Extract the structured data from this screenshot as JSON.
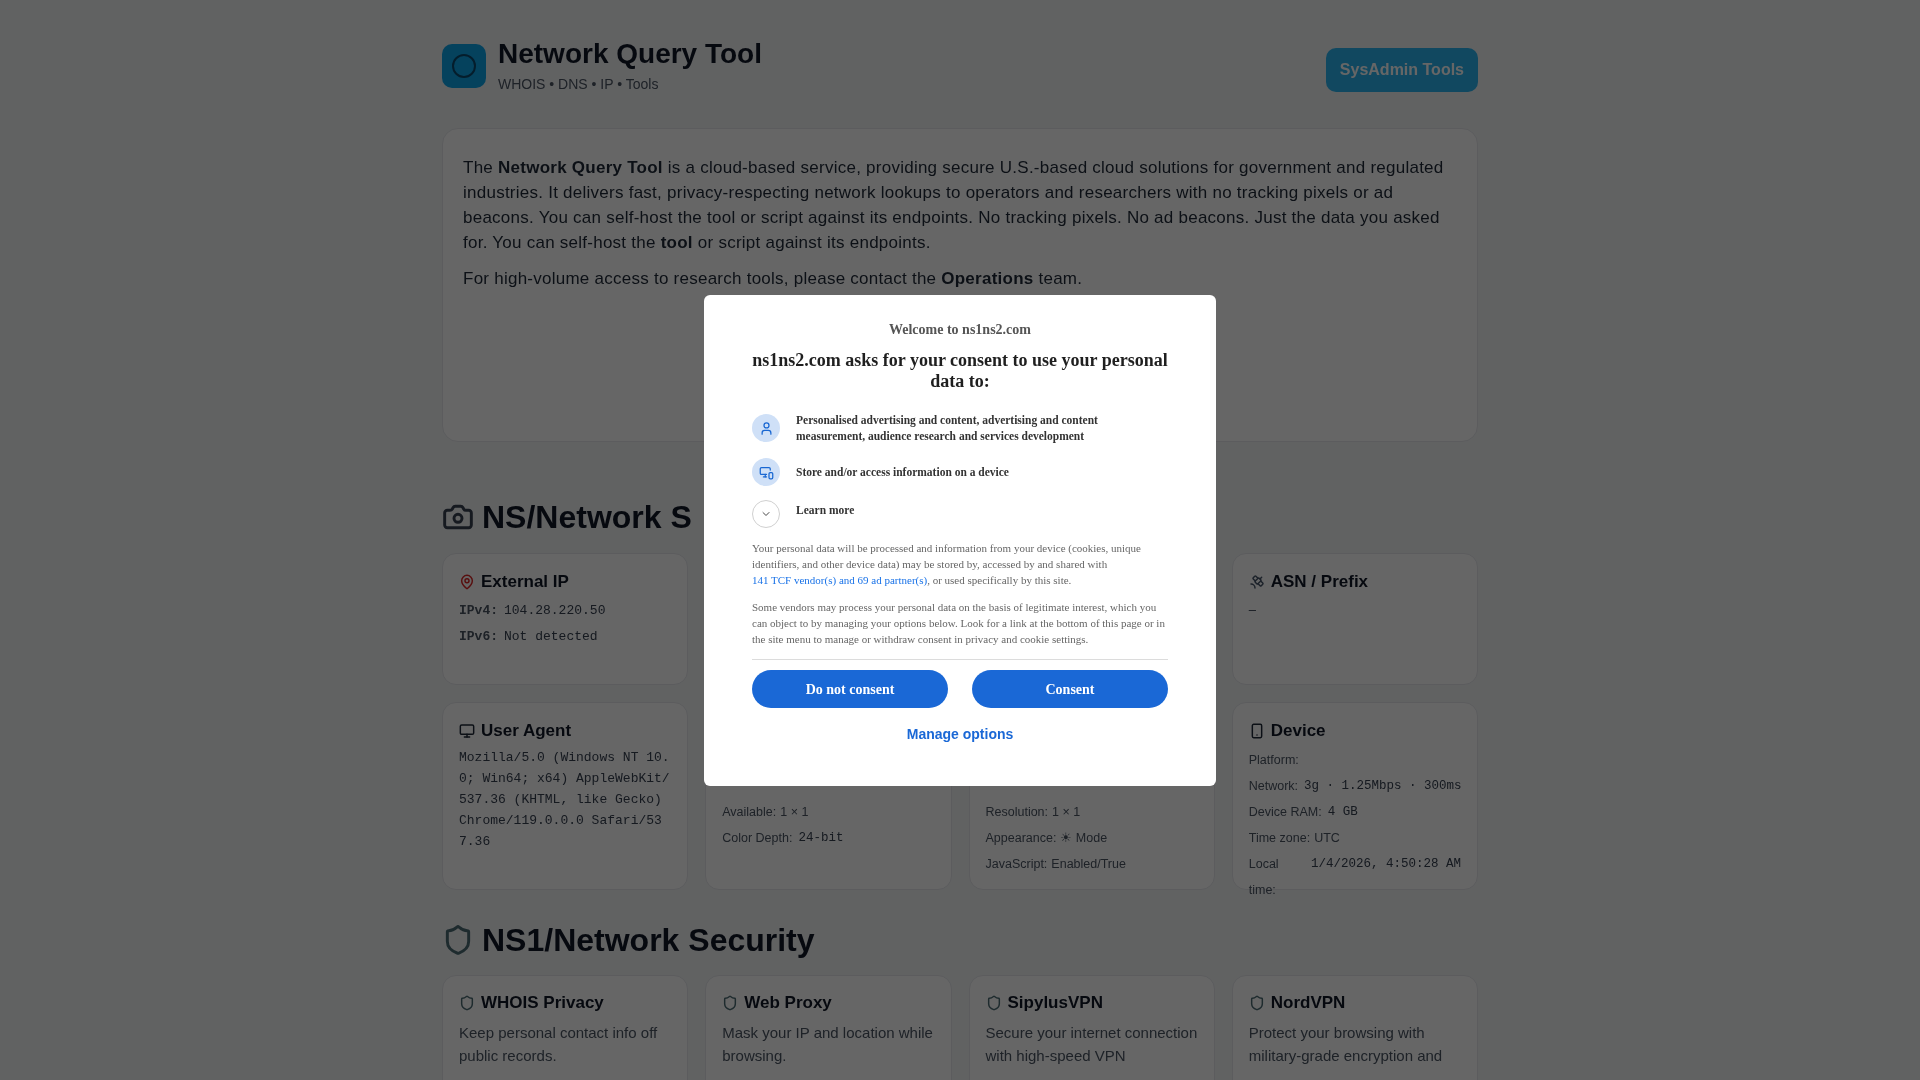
{
  "header": {
    "title": "Network Query Tool",
    "subtitle": "WHOIS • DNS • IP • Tools",
    "button": "SysAdmin Tools"
  },
  "intro": {
    "paragraphs": [
      "The **Network Query Tool** is a cloud-based service, providing secure U.S.-based cloud solutions for government and regulated industries. It delivers fast, privacy-respecting network lookups to operators and researchers with no tracking pixels or ad beacons. You can self-host the tool or script against its endpoints. No tracking pixels. No ad beacons. Just the data you asked for. You can self-host the **tool** or script against its endpoints.",
      "For high-volume access to research tools, please contact the **Operations** team."
    ]
  },
  "sections": [
    {
      "title": "NS/Network S",
      "cards": [
        {
          "title": "External IP",
          "lines": [
            {
              "kind": "mono",
              "label": "IPv4:",
              "value": "104.28.220.50"
            },
            {
              "kind": "mono",
              "label": "IPv6:",
              "value": "Not detected"
            }
          ]
        },
        {
          "title": "ASN / Prefix",
          "lines": [
            {
              "kind": "plain",
              "value": "–"
            }
          ]
        },
        {
          "title": "User Agent",
          "lines": [
            {
              "kind": "code",
              "value": "Mozilla/5.0 (Windows NT 10.0; Win64; x64) AppleWebKit/537.36 (KHTML, like Gecko) Chrome/119.0.0.0 Safari/537.36"
            }
          ]
        },
        {
          "lines": [
            {
              "kind": "field",
              "label": "Available:",
              "value": "1 × 1"
            },
            {
              "kind": "mono",
              "label": "Color Depth:",
              "value": "24-bit"
            }
          ]
        },
        {
          "lines": [
            {
              "kind": "field",
              "label": "Resolution:",
              "value": "1 × 1"
            },
            {
              "kind": "field",
              "label": "Appearance:",
              "value": "☀ Mode"
            },
            {
              "kind": "field",
              "label": "JavaScript:",
              "value": "Enabled/True"
            }
          ]
        },
        {
          "title": "Device",
          "lines": [
            {
              "kind": "field",
              "label": "Platform:"
            },
            {
              "kind": "mono",
              "label": "Network:",
              "value": "3g · 1.25Mbps · 300ms"
            },
            {
              "kind": "mono",
              "label": "Device RAM:",
              "value": "4 GB"
            },
            {
              "kind": "field",
              "label": "Time zone:",
              "value": "UTC"
            },
            {
              "kind": "mono",
              "label": "Local time:",
              "value": "1/4/2026, 4:50:28 AM"
            }
          ]
        }
      ]
    },
    {
      "title": "NS1/Network Security",
      "cards": [
        {
          "title": "WHOIS Privacy",
          "lines": [
            {
              "kind": "text",
              "value": "Keep personal contact info off public records."
            }
          ]
        },
        {
          "title": "Web Proxy",
          "lines": [
            {
              "kind": "text",
              "value": "Mask your IP and location while browsing."
            }
          ]
        },
        {
          "title": "SipylusVPN",
          "lines": [
            {
              "kind": "text",
              "value": "Secure your internet connection with high-speed VPN"
            }
          ]
        },
        {
          "title": "NordVPN",
          "lines": [
            {
              "kind": "text",
              "value": "Protect your browsing with military-grade encryption and"
            }
          ]
        }
      ]
    }
  ],
  "consent": {
    "welcome": "Welcome to ns1ns2.com",
    "heading": "ns1ns2.com asks for your consent to use your personal data to:",
    "purposes": [
      "Personalised advertising and content, advertising and content measurement, audience research and services development",
      "Store and/or access information on a device"
    ],
    "learn_more": {
      "label": "Learn more",
      "expanded": false
    },
    "notice": {
      "before": "Your personal data will be processed and information from your device (cookies, unique identifiers, and other device data) may be stored by, accessed by and shared with",
      "link": "141 TCF vendor(s) and 69 ad partner(s)",
      "after": ", or used specifically by this site."
    },
    "legitimate": "Some vendors may process your personal data on the basis of legitimate interest, which you can object to by managing your options below. Look for a link at the bottom of this page or in the site menu to manage or withdraw consent in privacy and cookie settings.",
    "buttons": [
      "Do not consent",
      "Consent"
    ],
    "manage": "Manage options"
  }
}
